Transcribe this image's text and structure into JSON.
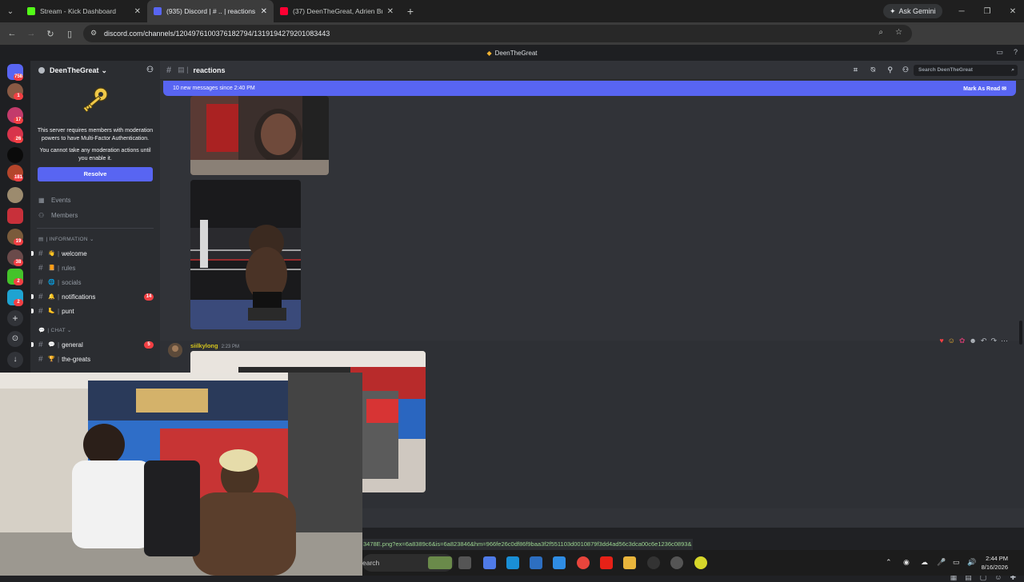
{
  "browser": {
    "tabs": [
      {
        "title": "Stream - Kick Dashboard",
        "fav_color": "#53fc18"
      },
      {
        "title": "(935) Discord | # .. | reactions",
        "fav_color": "#5865f2"
      },
      {
        "title": "(37) DeenTheGreat, Adrien Bro",
        "fav_color": "#ff0033"
      }
    ],
    "new_tab": "+",
    "ask_gemini": "Ask Gemini",
    "url": "discord.com/channels/1204976100376182794/1319194279201083443"
  },
  "discord": {
    "window_title": "DeenTheGreat",
    "server_name": "DeenTheGreat",
    "mfa_text_1": "This server requires members with moderation powers to have Multi-Factor Authentication.",
    "mfa_text_2": "You cannot take any moderation actions until you enable it.",
    "resolve_label": "Resolve",
    "nav": [
      {
        "label": "Events",
        "icon": "calendar-icon"
      },
      {
        "label": "Members",
        "icon": "members-icon"
      }
    ],
    "category_info": "| INFORMATION ⌄",
    "info_channels": [
      {
        "name": "welcome",
        "emoji": "👋",
        "unread": true,
        "mention": ""
      },
      {
        "name": "rules",
        "emoji": "📙",
        "unread": false,
        "mention": ""
      },
      {
        "name": "socials",
        "emoji": "🌐",
        "unread": false,
        "mention": ""
      },
      {
        "name": "notifications",
        "emoji": "🔔",
        "unread": true,
        "mention": "14"
      },
      {
        "name": "punt",
        "emoji": "🦶",
        "unread": true,
        "mention": ""
      }
    ],
    "category_chat": "| CHAT ⌄",
    "chat_channels": [
      {
        "name": "general",
        "emoji": "💬",
        "unread": true,
        "mention": "5"
      },
      {
        "name": "the-greats",
        "emoji": "🏆",
        "unread": true,
        "mention": ""
      }
    ],
    "guild_badges": [
      "758",
      "1",
      "17",
      "26",
      "181",
      "19",
      "38",
      "2",
      "2"
    ],
    "channel_name": "reactions",
    "search_placeholder": "Search DeenTheGreat",
    "new_messages_text": "10 new messages since 2:40 PM",
    "mark_as_read": "Mark As Read",
    "message": {
      "username": "siilkylong",
      "time": "2:23 PM"
    },
    "status_url": "3478E.png?ex=6a8389c6&is=6a823846&hm=966fe26c0df86f9baa3f2f551103d0010879f3dd4ad56c3dca00c6e1236c0893&"
  },
  "taskbar": {
    "search_text": "earch",
    "time": "2:44 PM",
    "date": "8/16/2026"
  },
  "colors": {
    "accent": "#5865f2",
    "mention": "#f23f43",
    "username": "#d4c41d"
  }
}
